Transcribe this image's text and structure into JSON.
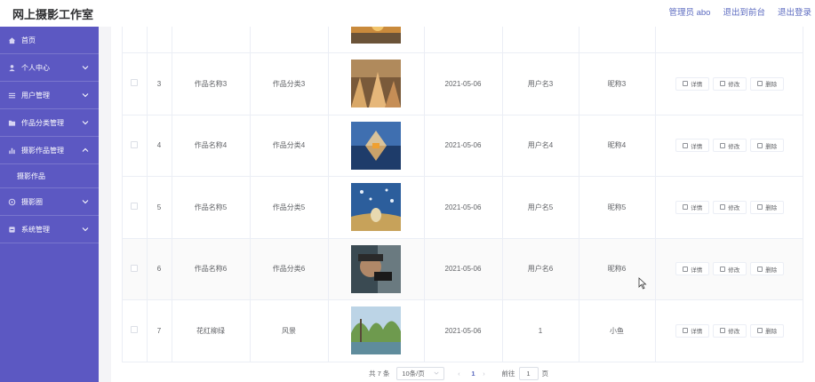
{
  "header": {
    "title": "网上摄影工作室",
    "admin": "管理员 abo",
    "back_front": "退出到前台",
    "logout": "退出登录"
  },
  "sidebar": {
    "items": [
      {
        "label": "首页",
        "icon": "home-icon",
        "has_chevron": false
      },
      {
        "label": "个人中心",
        "icon": "user-icon",
        "has_chevron": true
      },
      {
        "label": "用户管理",
        "icon": "list-icon",
        "has_chevron": true
      },
      {
        "label": "作品分类管理",
        "icon": "folder-icon",
        "has_chevron": true
      },
      {
        "label": "摄影作品管理",
        "icon": "bar-chart-icon",
        "has_chevron": true,
        "expanded": true,
        "sub": "摄影作品"
      },
      {
        "label": "摄影圈",
        "icon": "circle-icon",
        "has_chevron": true
      },
      {
        "label": "系统管理",
        "icon": "settings-icon",
        "has_chevron": true
      }
    ]
  },
  "table": {
    "rows": [
      {
        "no": "",
        "name": "",
        "category": "",
        "date": "",
        "username": "",
        "nickname": "",
        "image": "sunset-lake",
        "partial": true
      },
      {
        "no": "3",
        "name": "作品名称3",
        "category": "作品分类3",
        "date": "2021-05-06",
        "username": "用户名3",
        "nickname": "昵称3",
        "image": "golden-grass"
      },
      {
        "no": "4",
        "name": "作品名称4",
        "category": "作品分类4",
        "date": "2021-05-06",
        "username": "用户名4",
        "nickname": "昵称4",
        "image": "reflection-dusk"
      },
      {
        "no": "5",
        "name": "作品名称5",
        "category": "作品分类5",
        "date": "2021-05-06",
        "username": "用户名5",
        "nickname": "昵称5",
        "image": "bird-flight"
      },
      {
        "no": "6",
        "name": "作品名称6",
        "category": "作品分类6",
        "date": "2021-05-06",
        "username": "用户名6",
        "nickname": "昵称6",
        "image": "portrait-man"
      },
      {
        "no": "7",
        "name": "花红柳绿",
        "category": "风景",
        "date": "2021-05-06",
        "username": "1",
        "nickname": "小鱼",
        "image": "spring-lake"
      }
    ],
    "actions": {
      "detail": "详情",
      "edit": "修改",
      "delete": "删除"
    }
  },
  "pager": {
    "total": "共 7 条",
    "page_size": "10条/页",
    "current": "1",
    "goto_label": "前往",
    "goto_value": "1",
    "page_unit": "页"
  }
}
